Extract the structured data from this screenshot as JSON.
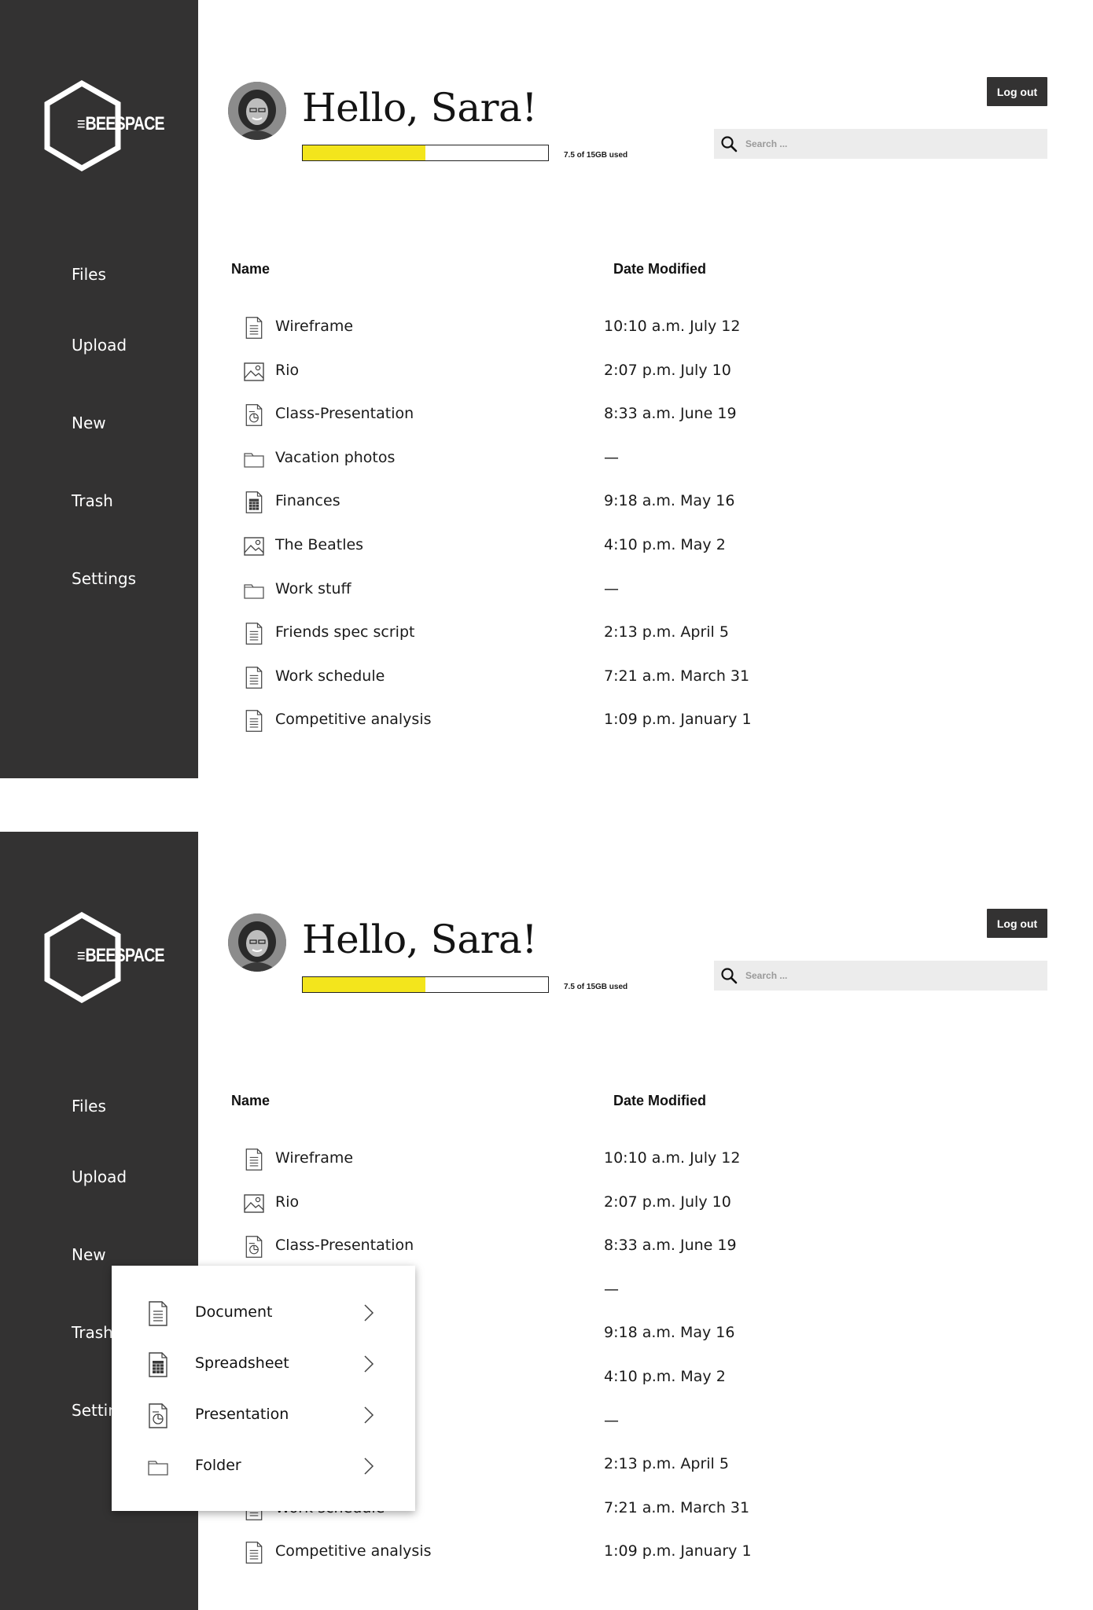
{
  "app": {
    "logo_text": "BEESPACE",
    "logo_bars": "≡"
  },
  "colors": {
    "sidebar": "#333232",
    "storage_fill": "#f3e51c",
    "search_bg": "#ececec"
  },
  "sidebar": {
    "items": [
      {
        "label": "Files",
        "icon": "none"
      },
      {
        "label": "Upload",
        "icon": "none"
      },
      {
        "label": "New",
        "icon": "none"
      },
      {
        "label": "Trash",
        "icon": "none"
      },
      {
        "label": "Settings",
        "icon": "none"
      }
    ]
  },
  "header": {
    "greeting": "Hello, Sara!",
    "storage_text": "7.5 of 15GB used",
    "storage_used_fraction": 0.5,
    "logout_label": "Log out",
    "search_placeholder": "Search ..."
  },
  "table": {
    "col_name": "Name",
    "col_date": "Date Modified",
    "rows": [
      {
        "name": "Wireframe",
        "date": "10:10 a.m. July 12",
        "icon": "document-icon"
      },
      {
        "name": "Rio",
        "date": "2:07 p.m. July 10",
        "icon": "image-icon"
      },
      {
        "name": "Class-Presentation",
        "date": "8:33 a.m. June 19",
        "icon": "presentation-icon"
      },
      {
        "name": "Vacation photos",
        "date": "—",
        "icon": "folder-icon"
      },
      {
        "name": "Finances",
        "date": "9:18 a.m. May 16",
        "icon": "spreadsheet-icon"
      },
      {
        "name": "The Beatles",
        "date": "4:10 p.m. May 2",
        "icon": "image-icon"
      },
      {
        "name": "Work stuff",
        "date": "—",
        "icon": "folder-icon"
      },
      {
        "name": "Friends spec script",
        "date": "2:13 p.m. April 5",
        "icon": "document-icon"
      },
      {
        "name": "Work schedule",
        "date": "7:21 a.m. March 31",
        "icon": "document-icon"
      },
      {
        "name": "Competitive analysis",
        "date": "1:09 p.m. January 1",
        "icon": "document-icon"
      }
    ]
  },
  "new_menu": {
    "items": [
      {
        "label": "Document",
        "icon": "document-icon"
      },
      {
        "label": "Spreadsheet",
        "icon": "spreadsheet-icon"
      },
      {
        "label": "Presentation",
        "icon": "presentation-icon"
      },
      {
        "label": "Folder",
        "icon": "folder-icon"
      }
    ]
  }
}
